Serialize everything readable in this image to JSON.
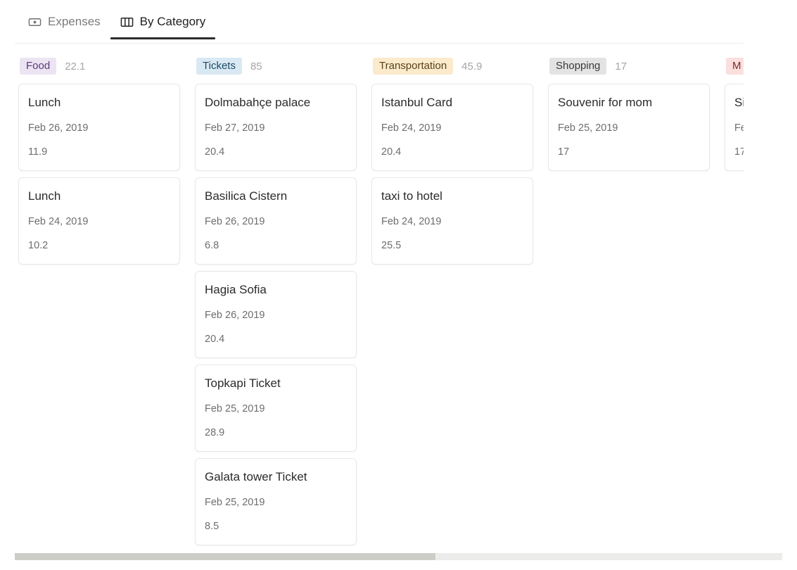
{
  "tabs": [
    {
      "label": "Expenses",
      "icon": "banknote-icon",
      "active": false
    },
    {
      "label": "By Category",
      "icon": "board-columns-icon",
      "active": true
    }
  ],
  "board": {
    "columns": [
      {
        "name": "Food",
        "total": "22.1",
        "badge_bg": "#ece3f3",
        "badge_fg": "#5b3a7a",
        "cards": [
          {
            "title": "Lunch",
            "date": "Feb 26, 2019",
            "amount": "11.9"
          },
          {
            "title": "Lunch",
            "date": "Feb 24, 2019",
            "amount": "10.2"
          }
        ]
      },
      {
        "name": "Tickets",
        "total": "85",
        "badge_bg": "#d9e9f4",
        "badge_fg": "#1f4a63",
        "cards": [
          {
            "title": "Dolmabahçe palace",
            "date": "Feb 27, 2019",
            "amount": "20.4"
          },
          {
            "title": "Basilica Cistern",
            "date": "Feb 26, 2019",
            "amount": "6.8"
          },
          {
            "title": "Hagia Sofia",
            "date": "Feb 26, 2019",
            "amount": "20.4"
          },
          {
            "title": "Topkapi Ticket",
            "date": "Feb 25, 2019",
            "amount": "28.9"
          },
          {
            "title": "Galata tower Ticket",
            "date": "Feb 25, 2019",
            "amount": "8.5"
          }
        ]
      },
      {
        "name": "Transportation",
        "total": "45.9",
        "badge_bg": "#fbeacb",
        "badge_fg": "#5b4319",
        "cards": [
          {
            "title": "Istanbul Card",
            "date": "Feb 24, 2019",
            "amount": "20.4"
          },
          {
            "title": "taxi to hotel",
            "date": "Feb 24, 2019",
            "amount": "25.5"
          }
        ]
      },
      {
        "name": "Shopping",
        "total": "17",
        "badge_bg": "#e3e3e3",
        "badge_fg": "#3a3a3a",
        "cards": [
          {
            "title": "Souvenir for mom",
            "date": "Feb 25, 2019",
            "amount": "17"
          }
        ]
      },
      {
        "name": "M",
        "total": "",
        "badge_bg": "#fbdfdd",
        "badge_fg": "#7a2b26",
        "cards": [
          {
            "title": "Si",
            "date": "Fe",
            "amount": "17"
          }
        ]
      }
    ]
  },
  "scrollbar": {
    "track_color": "#ececeb",
    "thumb_color": "#cdcdc8"
  }
}
